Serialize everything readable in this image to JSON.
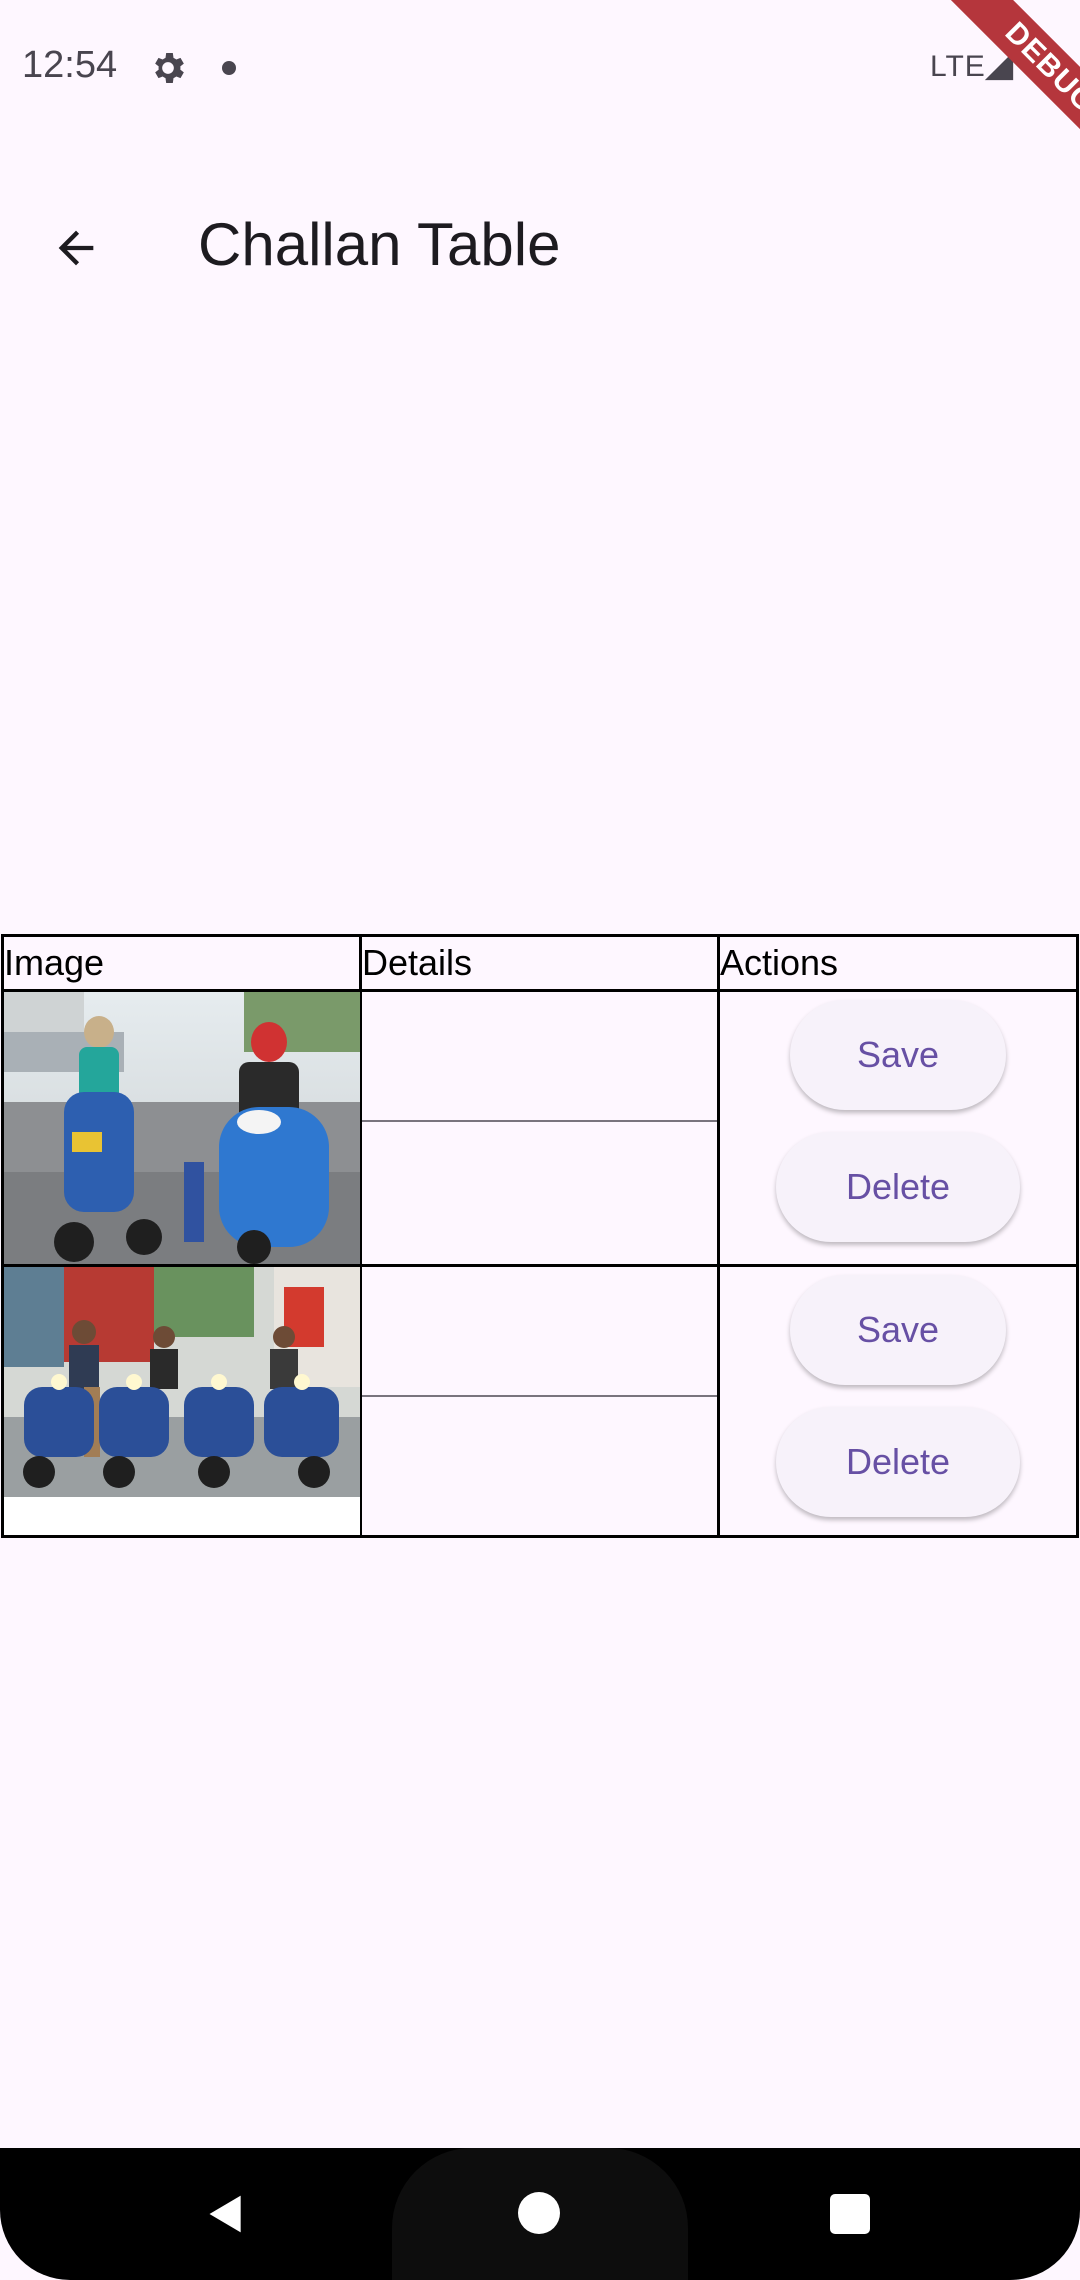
{
  "status_bar": {
    "time": "12:54",
    "network": "LTE",
    "debug_label": "DEBUG"
  },
  "app_bar": {
    "title": "Challan Table",
    "back_icon": "arrow-back-icon"
  },
  "table": {
    "headers": [
      "Image",
      "Details",
      "Actions"
    ],
    "rows": [
      {
        "image_desc": "photo-two-riders-blue-scooters",
        "details": [
          "",
          ""
        ],
        "actions": {
          "save": "Save",
          "delete": "Delete"
        }
      },
      {
        "image_desc": "photo-four-riders-blue-scooters",
        "details": [
          "",
          ""
        ],
        "actions": {
          "save": "Save",
          "delete": "Delete"
        }
      }
    ]
  },
  "colors": {
    "background": "#fef7ff",
    "button_bg": "#f7f2fa",
    "button_text": "#6750a4",
    "debug_ribbon": "#b5363c"
  },
  "nav_bar": {
    "icons": [
      "nav-back-icon",
      "nav-home-icon",
      "nav-recents-icon"
    ]
  }
}
